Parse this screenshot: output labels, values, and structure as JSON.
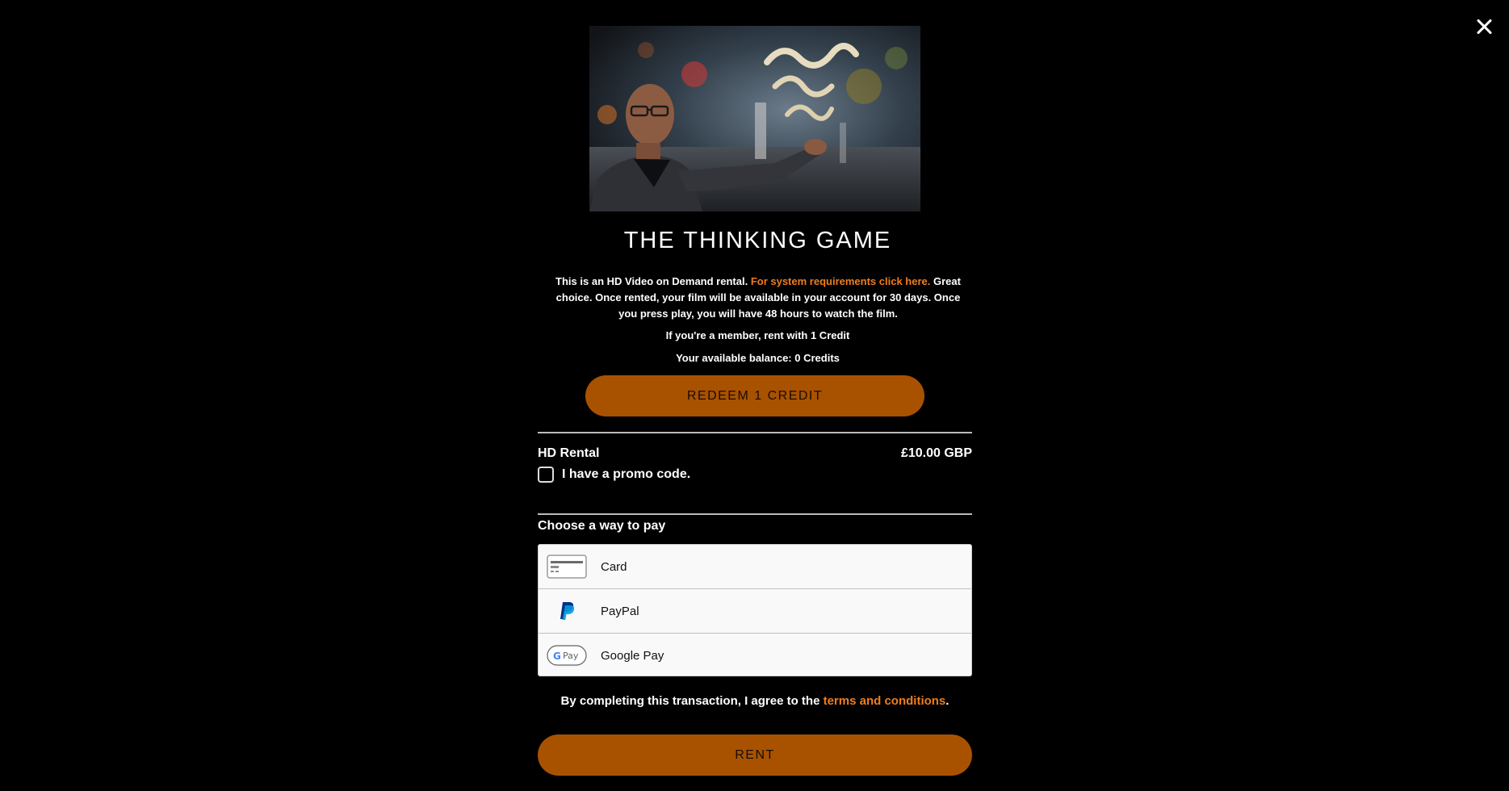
{
  "film": {
    "title": "THE THINKING GAME",
    "poster_alt": "Man in glasses gesturing at a sculpture"
  },
  "description": {
    "part1": "This is an HD Video on Demand rental. ",
    "link": "For system requirements click here.",
    "part2": " Great choice. Once rented, your film will be available in your account for 30 days. Once you press play, you will have 48 hours to watch the film."
  },
  "member_text": "If you're a member, rent with 1 Credit",
  "balance_text": "Your available balance: 0 Credits",
  "redeem_label": "REDEEM 1 CREDIT",
  "rental": {
    "label": "HD Rental",
    "price": "£10.00 GBP"
  },
  "promo": {
    "label": "I have a promo code.",
    "checked": false
  },
  "payment": {
    "heading": "Choose a way to pay",
    "options": [
      {
        "label": "Card",
        "icon": "credit-card-icon"
      },
      {
        "label": "PayPal",
        "icon": "paypal-icon"
      },
      {
        "label": "Google Pay",
        "icon": "google-pay-icon"
      }
    ]
  },
  "terms": {
    "prefix": "By completing this transaction, I agree to the ",
    "link": "terms and conditions",
    "suffix": "."
  },
  "rent_label": "RENT",
  "colors": {
    "background": "#000000",
    "accent_button": "#a85200",
    "link": "#ef7d1e",
    "text": "#ffffff"
  }
}
